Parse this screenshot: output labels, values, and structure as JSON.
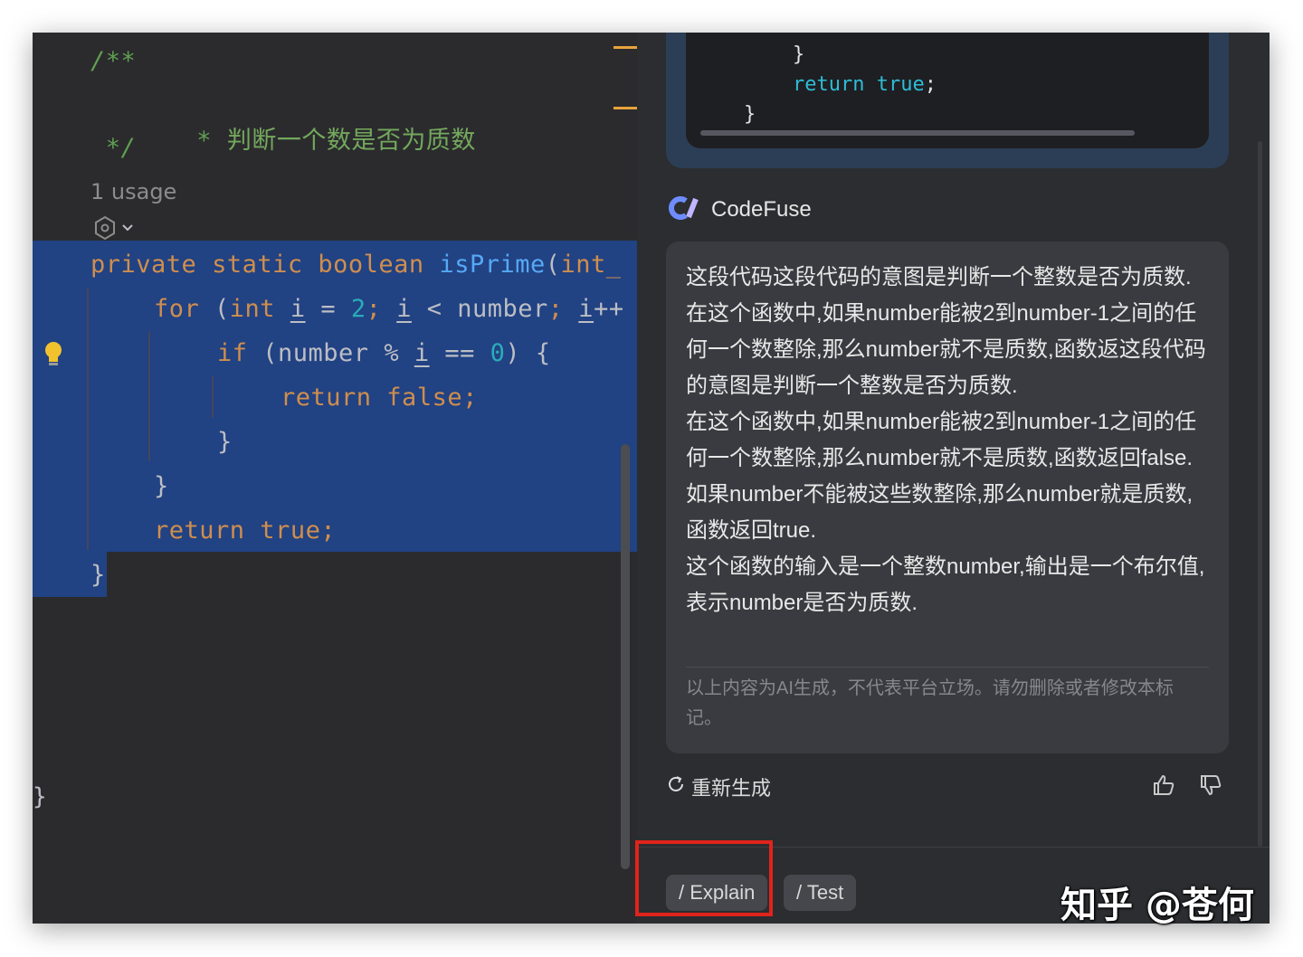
{
  "editor": {
    "comment_open": "/**",
    "comment_star": " * ",
    "comment_text": "判断一个数是否为质数",
    "comment_close": " */",
    "usage": "1 usage",
    "line1": {
      "kw1": "private",
      "kw2": "static",
      "kw3": "boolean",
      "fn": "isPrime",
      "paren": "(",
      "kw4": "int_"
    },
    "line2": {
      "kw": "for",
      "p1": " (",
      "kw2": "int",
      "v": "i",
      "eq": " = ",
      "n": "2",
      "sc": ";",
      "v2": "i",
      "lt": " < number",
      "sc2": ";",
      "v3": "i",
      "inc": "++"
    },
    "line3": {
      "kw": "if",
      "rest1": " (number % ",
      "v": "i",
      "rest2": " == ",
      "n": "0",
      "rest3": ") {"
    },
    "line4": {
      "kw": "return",
      "rest": " false;"
    },
    "brace_inner": "}",
    "brace_for": "}",
    "line7": {
      "kw": "return",
      "rest": " true;"
    },
    "brace_fn": "}",
    "brace_class": "}"
  },
  "panel": {
    "codeblock": {
      "brace1": "}",
      "ret_kw": "return",
      "ret_val": " true",
      "ret_sc": ";",
      "brace2": "}"
    },
    "bot_name": "CodeFuse",
    "answer": "这段代码这段代码的意图是判断一个整数是否为质数.\n在这个函数中,如果number能被2到number-1之间的任何一个数整除,那么number就不是质数,函数返这段代码的意图是判断一个整数是否为质数.\n在这个函数中,如果number能被2到number-1之间的任何一个数整除,那么number就不是质数,函数返回false.如果number不能被这些数整除,那么number就是质数,函数返回true.\n这个函数的输入是一个整数number,输出是一个布尔值,表示number是否为质数.",
    "disclaimer": "以上内容为AI生成，不代表平台立场。请勿删除或者修改本标记。",
    "regenerate": "重新生成",
    "chips": {
      "explain": "/ Explain",
      "test": "/ Test"
    }
  },
  "watermark": "知乎 @苍何",
  "colors": {
    "selection": "#214283",
    "keyword": "#cf8e4e",
    "function": "#56a8f5",
    "number": "#2aacb8",
    "comment": "#5f9f52",
    "highlight_box": "#e0231b"
  }
}
